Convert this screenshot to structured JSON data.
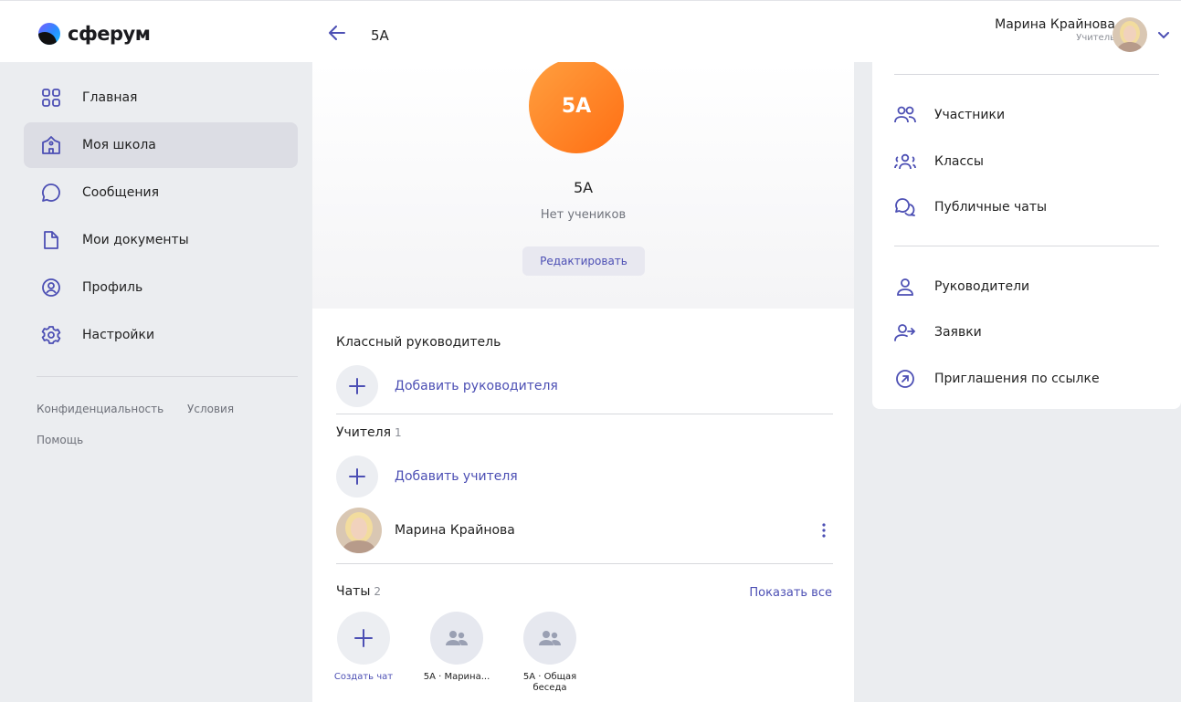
{
  "app": {
    "logo_text": "сферум"
  },
  "header": {
    "title": "5A"
  },
  "user": {
    "name": "Марина Крайнова",
    "role": "Учитель"
  },
  "sidebar": {
    "items": [
      {
        "label": "Главная",
        "icon": "grid-icon"
      },
      {
        "label": "Моя школа",
        "icon": "school-icon",
        "active": true
      },
      {
        "label": "Сообщения",
        "icon": "message-icon"
      },
      {
        "label": "Мои документы",
        "icon": "document-icon"
      },
      {
        "label": "Профиль",
        "icon": "profile-icon"
      },
      {
        "label": "Настройки",
        "icon": "gear-icon"
      }
    ],
    "links": {
      "privacy": "Конфиденциальность",
      "terms": "Условия",
      "help": "Помощь"
    }
  },
  "main": {
    "avatar_text": "5А",
    "class_name": "5А",
    "students_status": "Нет учеников",
    "edit_label": "Редактировать",
    "homeroom": {
      "title": "Классный руководитель",
      "add_label": "Добавить руководителя"
    },
    "teachers": {
      "title": "Учителя",
      "count": "1",
      "add_label": "Добавить учителя",
      "items": [
        {
          "name": "Марина Крайнова"
        }
      ]
    },
    "chats": {
      "title": "Чаты",
      "count": "2",
      "show_all": "Показать все",
      "create_label": "Создать чат",
      "items": [
        {
          "label": "5А · Марина..."
        },
        {
          "label": "5А · Общая беседа"
        }
      ]
    }
  },
  "right_panel": {
    "group1": [
      {
        "label": "Участники"
      },
      {
        "label": "Классы"
      },
      {
        "label": "Публичные чаты"
      }
    ],
    "group2": [
      {
        "label": "Руководители"
      },
      {
        "label": "Заявки"
      },
      {
        "label": "Приглашения по ссылке"
      }
    ]
  },
  "colors": {
    "accent": "#4c4fb4",
    "orange": "#ff7a1f",
    "active_bg": "#dcdde4"
  }
}
